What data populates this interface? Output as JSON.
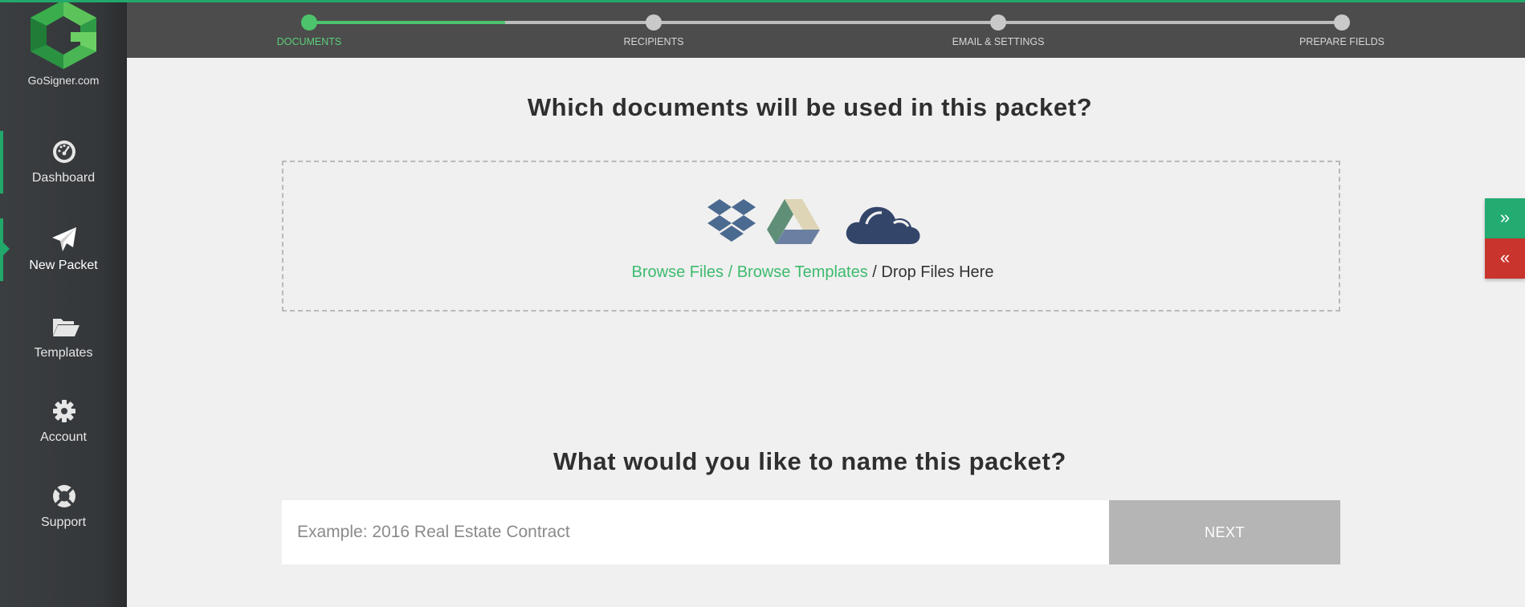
{
  "brand": {
    "name": "GoSigner.com"
  },
  "sidebar": {
    "items": [
      {
        "label": "Dashboard",
        "icon": "dashboard-gauge-icon"
      },
      {
        "label": "New Packet",
        "icon": "paper-plane-icon"
      },
      {
        "label": "Templates",
        "icon": "folder-open-icon"
      },
      {
        "label": "Account",
        "icon": "gear-icon"
      },
      {
        "label": "Support",
        "icon": "life-ring-icon"
      }
    ]
  },
  "progress": {
    "completion": 0.19,
    "steps": [
      {
        "label": "DOCUMENTS",
        "state": "done"
      },
      {
        "label": "RECIPIENTS",
        "state": "pending"
      },
      {
        "label": "EMAIL & SETTINGS",
        "state": "pending"
      },
      {
        "label": "PREPARE FIELDS",
        "state": "pending"
      }
    ]
  },
  "documents": {
    "question": "Which documents will be used in this packet?",
    "providers": [
      "dropbox-icon",
      "google-drive-icon",
      "onedrive-cloud-icon"
    ],
    "browse_files": "Browse Files",
    "separator": " / ",
    "browse_templates": "Browse Templates",
    "drop_text": " / Drop Files Here"
  },
  "naming": {
    "question": "What would you like to name this packet?",
    "placeholder": "Example: 2016 Real Estate Contract",
    "value": "",
    "next_label": "NEXT"
  },
  "side_tabs": {
    "expand_glyph": "»",
    "collapse_glyph": "«"
  },
  "colors": {
    "accent_green": "#22a86b",
    "progress_green": "#4cc36c",
    "link_green": "#3dbb6e",
    "danger_red": "#c9342c",
    "sidebar_bg": "#3b3e41",
    "header_bg": "#4c4c4c"
  }
}
